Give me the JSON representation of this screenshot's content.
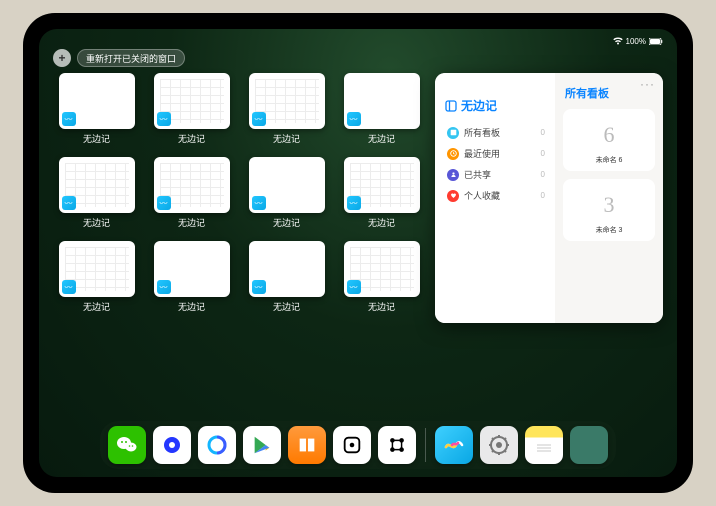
{
  "statusbar": {
    "time": "",
    "battery_pct": "100%"
  },
  "topbar": {
    "plus_label": "+",
    "reopen_label": "重新打开已关闭的窗口"
  },
  "window_grid": {
    "items": [
      {
        "label": "无边记",
        "style": "blank"
      },
      {
        "label": "无边记",
        "style": "cal"
      },
      {
        "label": "无边记",
        "style": "cal"
      },
      {
        "label": "无边记",
        "style": "blank"
      },
      {
        "label": "无边记",
        "style": "cal"
      },
      {
        "label": "无边记",
        "style": "cal"
      },
      {
        "label": "无边记",
        "style": "blank"
      },
      {
        "label": "无边记",
        "style": "cal"
      },
      {
        "label": "无边记",
        "style": "cal"
      },
      {
        "label": "无边记",
        "style": "blank"
      },
      {
        "label": "无边记",
        "style": "blank"
      },
      {
        "label": "无边记",
        "style": "cal"
      }
    ]
  },
  "panel": {
    "title": "无边记",
    "right_title": "所有看板",
    "more": "···",
    "sidebar": [
      {
        "label": "所有看板",
        "count": "0",
        "icon": "all"
      },
      {
        "label": "最近使用",
        "count": "0",
        "icon": "recent"
      },
      {
        "label": "已共享",
        "count": "0",
        "icon": "shared"
      },
      {
        "label": "个人收藏",
        "count": "0",
        "icon": "fav"
      }
    ],
    "boards": [
      {
        "glyph": "6",
        "name": "未命名 6",
        "date": ""
      },
      {
        "glyph": "3",
        "name": "未命名 3",
        "date": ""
      }
    ]
  },
  "dock": {
    "apps": [
      {
        "name": "wechat"
      },
      {
        "name": "quark"
      },
      {
        "name": "qq-browser"
      },
      {
        "name": "google-play"
      },
      {
        "name": "books"
      },
      {
        "name": "dice-app"
      },
      {
        "name": "connect-app"
      }
    ],
    "recent": [
      {
        "name": "freeform"
      },
      {
        "name": "settings"
      },
      {
        "name": "notes"
      },
      {
        "name": "app-library"
      }
    ]
  }
}
